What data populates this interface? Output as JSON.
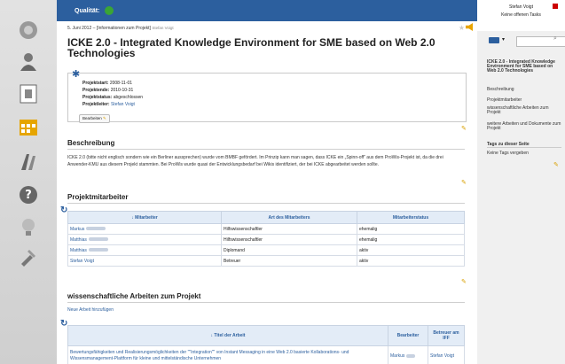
{
  "left_nav": {
    "icons": [
      "settings-icon",
      "user-icon",
      "file-icon",
      "calendar-icon",
      "people-icon",
      "help-icon",
      "lamp-icon",
      "tools-icon"
    ]
  },
  "top": {
    "quality_label": "Qualität:"
  },
  "page_meta": {
    "date": "5. Juni 2012 – [Informationen zum Projekt]",
    "source": "Stefan Voigt"
  },
  "title": "ICKE 2.0 - Integrated Knowledge Environment for SME based on Web 2.0 Technologies",
  "info": {
    "projektstart_label": "Projektstart:",
    "projektstart": "2008-11-01",
    "projektende_label": "Projektende:",
    "projektende": "2010-10-31",
    "projektstatus_label": "Projektstatus:",
    "projektstatus": "abgeschlossen",
    "projektleiter_label": "Projektleiter:",
    "projektleiter": "Stefan Voigt",
    "edit_label": "Bearbeiten"
  },
  "beschreibung": {
    "heading": "Beschreibung",
    "text": "ICKE 2.0 (bitte nicht englisch sondern wie ein Berliner aussprechen) wurde vom BMBF gefördert. Im Prinzip kann man sagen, dass ICKE ein „Spinn-off“ aus dem ProWis-Projekt ist, da die drei Anwender-KMU aus diesem Projekt stammten. Bei ProWis wurde quasi der Entwicklungsbedarf bei Wikis identifiziert, der bei ICKE abgearbeitet werden sollte."
  },
  "mitarbeiter": {
    "heading": "Projektmitarbeiter",
    "columns": [
      "↓ Mitarbeiter",
      "Art des Mitarbeiters",
      "Mitarbeiterstatus"
    ],
    "rows": [
      {
        "name": "Markus",
        "art": "Hilfswissenschaftler",
        "status": "ehemalig"
      },
      {
        "name": "Matthias",
        "art": "Hilfswissenschaftler",
        "status": "ehemalig"
      },
      {
        "name": "Matthias",
        "art": "Diplomand",
        "status": "aktiv"
      },
      {
        "name": "Stefan Voigt",
        "art": "Betreuer",
        "status": "aktiv"
      }
    ]
  },
  "arbeiten": {
    "heading": "wissenschaftliche Arbeiten zum Projekt",
    "new_link": "Neue Arbeit hinzufügen",
    "columns": [
      "↓ Titel der Arbeit",
      "Bearbeiter",
      "Betreuer am IFF"
    ],
    "rows": [
      {
        "title": "Bewertungsfähigkeiten und Realisierungsmöglichkeiten der \"\"Integration\"\" von Instant Messaging in eine Web 2.0 basierte Kollaborations- und Wissensmanagement-Plattform für kleine und mittelständische Unternehmen",
        "bearbeiter": "Markus",
        "betreuer": "Stefan Voigt"
      }
    ]
  },
  "right_sidebar": {
    "user": "Stefan Voigt",
    "tasks": "Keine offenen Tasks",
    "toc_title": "ICKE 2.0 - Integrated Knowledge Environment for SME based on Web 2.0 Technologies",
    "toc": [
      "Beschreibung",
      "Projektmitarbeiter",
      "wissenschaftliche Arbeiten zum Projekt",
      "weitere Arbeiten und Dokumente zum Projekt"
    ],
    "tags_heading": "Tags zu dieser Seite",
    "tags_value": "Keine Tags vergeben"
  }
}
